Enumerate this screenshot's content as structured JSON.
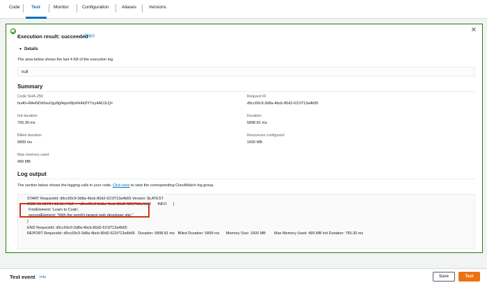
{
  "tabs": [
    {
      "label": "Code"
    },
    {
      "label": "Test"
    },
    {
      "label": "Monitor"
    },
    {
      "label": "Configuration"
    },
    {
      "label": "Aliases"
    },
    {
      "label": "Versions"
    }
  ],
  "result": {
    "title": "Execution result: succeeded",
    "logs_link": "(logs)",
    "details_label": "Details",
    "info_text": "The area below shows the last 4 KB of the execution log.",
    "output_value": "null"
  },
  "summary": {
    "title": "Summary",
    "code_sha_label": "Code SHA-256",
    "code_sha_value": "hu40+RAeNDd/IavOgz8gNqosWjnFk4kDYYzy4ADJLQ=",
    "request_id_label": "Request ID",
    "request_id_value": "d9cc69c9-3d8a-4bcb-80d2-621f713a4b65",
    "init_duration_label": "Init duration",
    "init_duration_value": "765.30 ms",
    "duration_label": "Duration",
    "duration_value": "5898.81 ms",
    "billed_duration_label": "Billed duration",
    "billed_duration_value": "5899 ms",
    "resources_label": "Resources configured",
    "resources_value": "1600 MB",
    "max_memory_label": "Max memory used",
    "max_memory_value": "499 MB"
  },
  "log_output": {
    "title": "Log output",
    "desc_before": "The section below shows the logging calls in your code.",
    "desc_link": "Click here",
    "desc_after": "to view the corresponding CloudWatch log group.",
    "lines": [
      "START RequestId: d9cc69c9-3d8a-4bcb-80d2-621f713a4b65 Version: $LATEST",
      "2023-01-31T04:18:11.441Z      d9cc69c9-3d8a-4bcb-80d2-621f713a4b65      INFO      {",
      "FirstElement: 'Learn to Code',",
      "secondElement: \"With the world's largest web developer site.\"",
      "}",
      "END RequestId: d9cc69c9-3d8a-4bcb-80d2-621f713a4b65",
      "REPORT RequestId: d9cc69c9-3d8a-4bcb-80d2-621f713a4b65   Duration: 5898.81 ms   Billed Duration: 5899 ms      Memory Size: 1600 MB        Max Memory Used: 499 MB Init Duration: 765.30 ms"
    ]
  },
  "bottom": {
    "title": "Test event",
    "info": "Info",
    "save_label": "Save",
    "test_label": "Test"
  },
  "colors": {
    "success": "#1d8102",
    "link": "#0073bb",
    "primary_button": "#ec7211",
    "highlight_box": "#d13212"
  }
}
